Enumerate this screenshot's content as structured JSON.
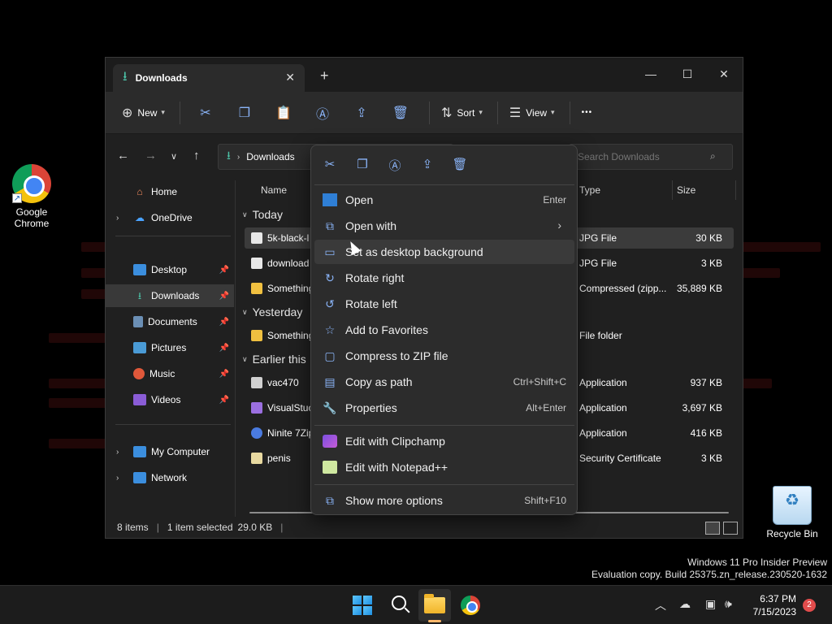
{
  "desktop": {
    "icons": [
      {
        "label": "Google Chrome",
        "icon": "chrome-icon"
      },
      {
        "label": "Recycle Bin",
        "icon": "recycle-bin-icon"
      }
    ],
    "watermark": {
      "line1": "Windows 11 Pro Insider Preview",
      "line2": "Evaluation copy. Build 25375.zn_release.230520-1632"
    }
  },
  "explorer": {
    "tab": {
      "title": "Downloads",
      "close_glyph": "✕"
    },
    "new_tab_glyph": "+",
    "window_controls": {
      "minimize": "—",
      "maximize": "☐",
      "close": "✕"
    },
    "toolbar": {
      "new_label": "New",
      "sort_label": "Sort",
      "view_label": "View",
      "more_glyph": "•••"
    },
    "address": {
      "path": "Downloads"
    },
    "search": {
      "placeholder": "Search Downloads"
    },
    "nav": {
      "home": "Home",
      "onedrive": "OneDrive",
      "desktop": "Desktop",
      "downloads": "Downloads",
      "documents": "Documents",
      "pictures": "Pictures",
      "music": "Music",
      "videos": "Videos",
      "my_computer": "My Computer",
      "network": "Network"
    },
    "columns": {
      "name": "Name",
      "type": "Type",
      "size": "Size"
    },
    "groups": {
      "today": "Today",
      "yesterday": "Yesterday",
      "earlier": "Earlier this"
    },
    "files": [
      {
        "name": "5k-black-l",
        "type": "JPG File",
        "size": "30 KB"
      },
      {
        "name": "download",
        "type": "JPG File",
        "size": "3 KB"
      },
      {
        "name": "Something",
        "type": "Compressed (zipp...",
        "size": "35,889 KB"
      },
      {
        "name": "Something",
        "type": "File folder",
        "size": ""
      },
      {
        "name": "vac470",
        "type": "Application",
        "size": "937 KB"
      },
      {
        "name": "VisualStuc",
        "type": "Application",
        "size": "3,697 KB"
      },
      {
        "name": "Ninite 7Zip",
        "type": "Application",
        "size": "416 KB"
      },
      {
        "name": "penis",
        "type": "Security Certificate",
        "size": "3 KB"
      }
    ],
    "status": {
      "items": "8 items",
      "selected": "1 item selected",
      "selected_size": "29.0 KB"
    }
  },
  "context_menu": {
    "items": [
      {
        "label": "Open",
        "shortcut": "Enter"
      },
      {
        "label": "Open with",
        "shortcut": ""
      },
      {
        "label": "Set as desktop background",
        "shortcut": ""
      },
      {
        "label": "Rotate right",
        "shortcut": ""
      },
      {
        "label": "Rotate left",
        "shortcut": ""
      },
      {
        "label": "Add to Favorites",
        "shortcut": ""
      },
      {
        "label": "Compress to ZIP file",
        "shortcut": ""
      },
      {
        "label": "Copy as path",
        "shortcut": "Ctrl+Shift+C"
      },
      {
        "label": "Properties",
        "shortcut": "Alt+Enter"
      },
      {
        "label": "Edit with Clipchamp",
        "shortcut": ""
      },
      {
        "label": "Edit with Notepad++",
        "shortcut": ""
      },
      {
        "label": "Show more options",
        "shortcut": "Shift+F10"
      }
    ]
  },
  "taskbar": {
    "time": "6:37 PM",
    "date": "7/15/2023",
    "notification_count": "2"
  },
  "colors": {
    "accent": "#8ab4f8",
    "downloads_green": "#4cc2a7",
    "window_bg": "#202020",
    "menu_bg": "#2c2c2c"
  }
}
